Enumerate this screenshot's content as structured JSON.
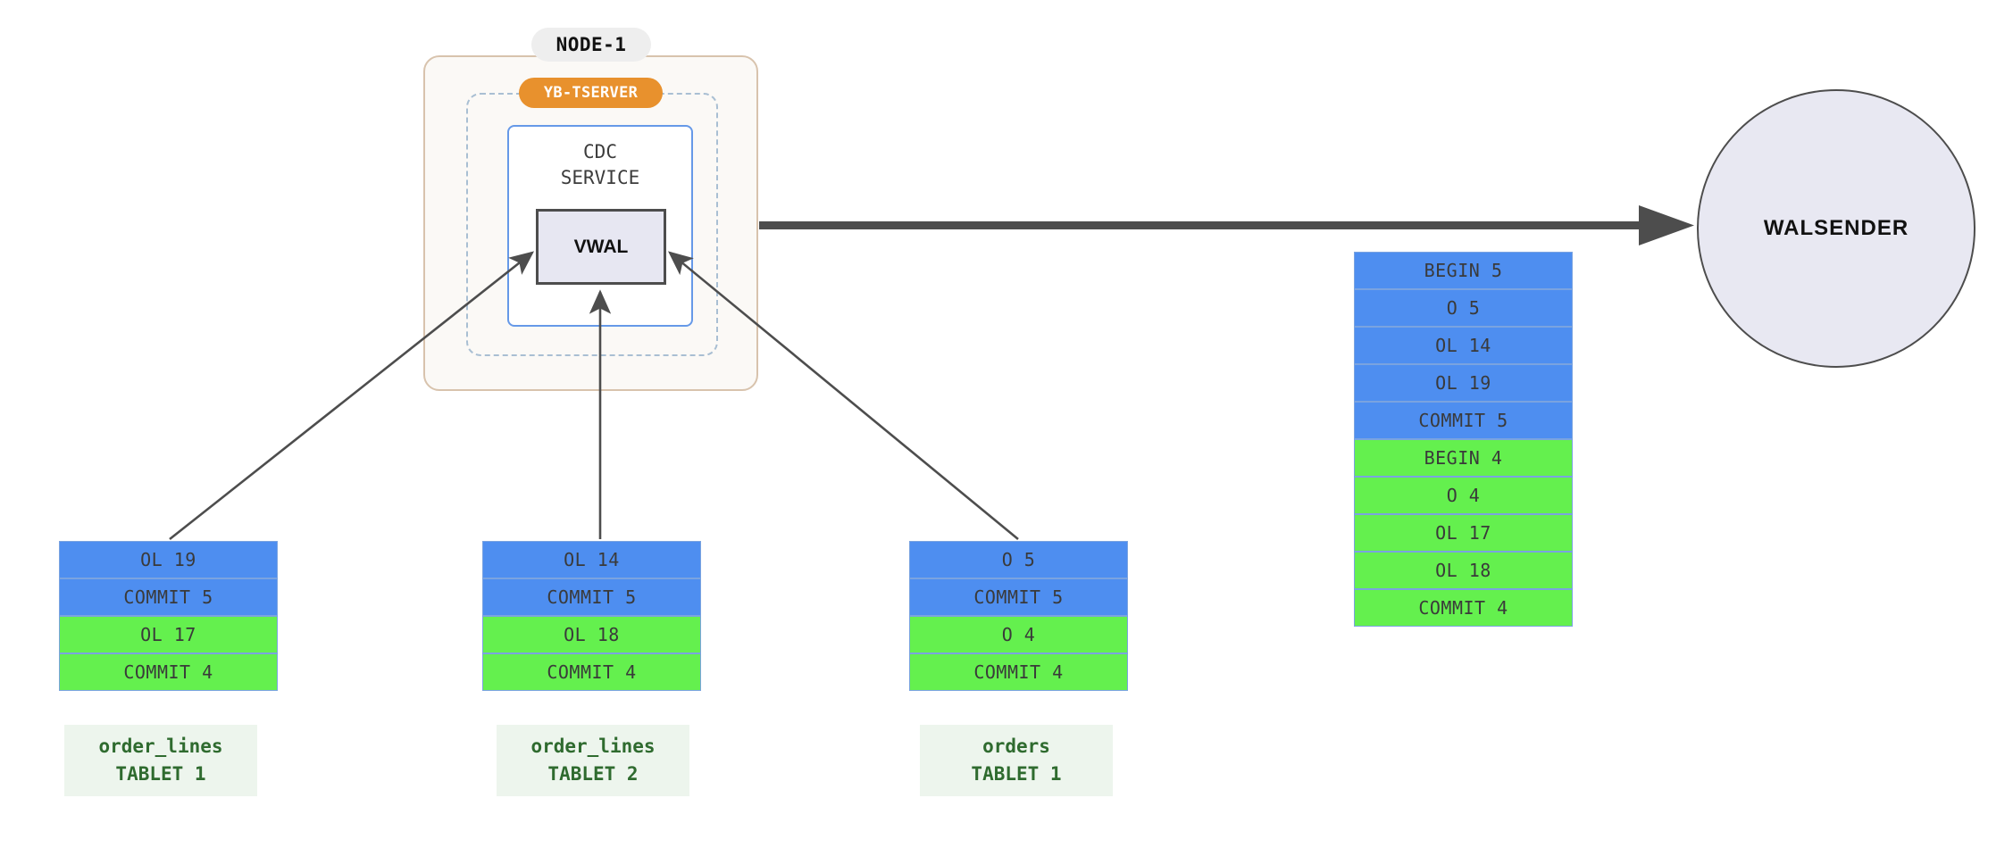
{
  "node": {
    "title": "NODE-1",
    "service_pill": "YB-TSERVER",
    "cdc_service_label": "CDC\nSERVICE",
    "vwal_label": "VWAL"
  },
  "walsender": {
    "label": "WALSENDER"
  },
  "colors": {
    "txn5": "#4e8ef0",
    "txn4": "#64f04e",
    "record_border": "#7aa3e0",
    "node_border": "#d8c3ad",
    "node_fill": "#fbf9f6",
    "tserver_pill": "#e8912d",
    "tserver_dashed": "#a9bfd3",
    "cdc_border": "#6699e8",
    "vwal_fill": "#e7e7f2",
    "vwal_border": "#4d4d4d",
    "walsender_fill": "#e8e8f2",
    "arrow": "#4d4d4d",
    "tablet_label_bg": "#edf5ed",
    "tablet_label_text": "#2f6b2f"
  },
  "vwal_stream": {
    "name": "vwal-output-stream",
    "records": [
      {
        "text": "BEGIN 5",
        "txn": "5"
      },
      {
        "text": "O 5",
        "txn": "5"
      },
      {
        "text": "OL 14",
        "txn": "5"
      },
      {
        "text": "OL 19",
        "txn": "5"
      },
      {
        "text": "COMMIT 5",
        "txn": "5"
      },
      {
        "text": "BEGIN 4",
        "txn": "4"
      },
      {
        "text": "O 4",
        "txn": "4"
      },
      {
        "text": "OL 17",
        "txn": "4"
      },
      {
        "text": "OL 18",
        "txn": "4"
      },
      {
        "text": "COMMIT 4",
        "txn": "4"
      }
    ]
  },
  "tablets": [
    {
      "name": "order_lines",
      "tablet": "TABLET 1",
      "records": [
        {
          "text": "OL 19",
          "txn": "5"
        },
        {
          "text": "COMMIT 5",
          "txn": "5"
        },
        {
          "text": "OL 17",
          "txn": "4"
        },
        {
          "text": "COMMIT 4",
          "txn": "4"
        }
      ]
    },
    {
      "name": "order_lines",
      "tablet": "TABLET 2",
      "records": [
        {
          "text": "OL 14",
          "txn": "5"
        },
        {
          "text": "COMMIT 5",
          "txn": "5"
        },
        {
          "text": "OL 18",
          "txn": "4"
        },
        {
          "text": "COMMIT 4",
          "txn": "4"
        }
      ]
    },
    {
      "name": "orders",
      "tablet": "TABLET 1",
      "records": [
        {
          "text": "O 5",
          "txn": "5"
        },
        {
          "text": "COMMIT 5",
          "txn": "5"
        },
        {
          "text": "O 4",
          "txn": "4"
        },
        {
          "text": "COMMIT 4",
          "txn": "4"
        }
      ]
    }
  ]
}
